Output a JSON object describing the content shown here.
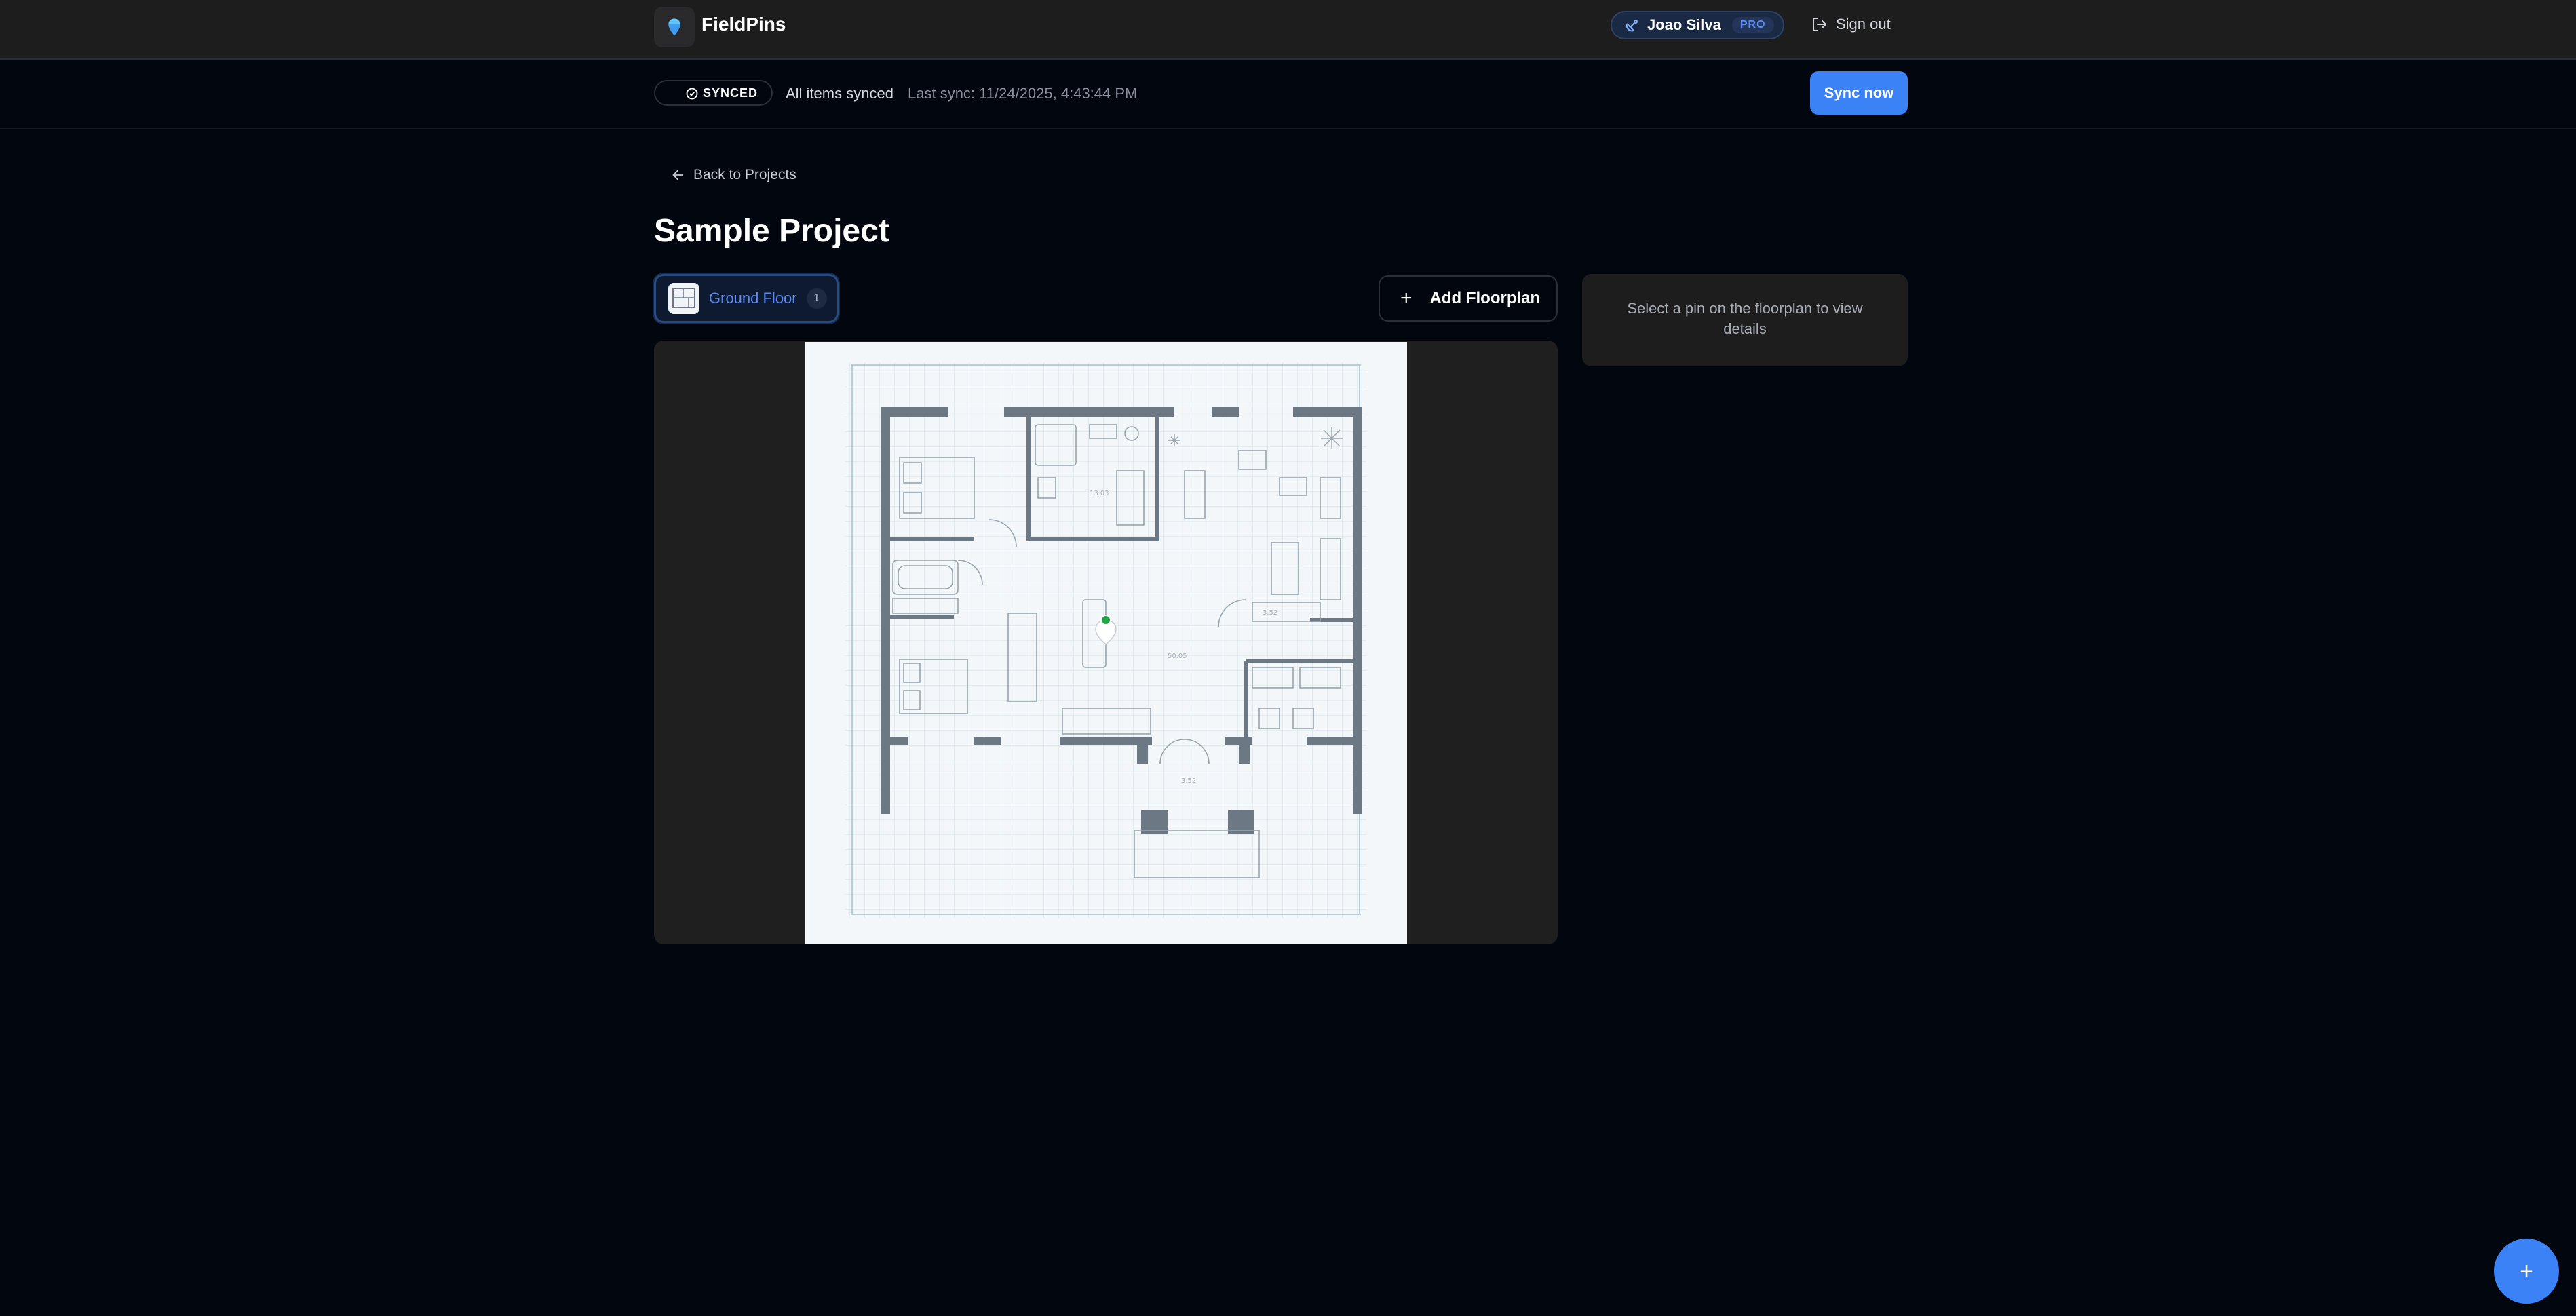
{
  "app": {
    "brand": "FieldPins",
    "logo_icon": "map-pin-icon",
    "accent_color": "#3b82f6"
  },
  "user": {
    "name": "Joao Silva",
    "plan_badge": "PRO",
    "avatar_icon": "satellite-dish-icon"
  },
  "nav": {
    "signout_label": "Sign out"
  },
  "sync": {
    "badge_label": "SYNCED",
    "status_text": "All items synced",
    "last_sync": "Last sync: 11/24/2025, 4:43:44 PM",
    "button_label": "Sync now"
  },
  "project": {
    "back_label": "Back to Projects",
    "title": "Sample Project",
    "floorplans": [
      {
        "name": "Ground Floor",
        "pin_count": "1",
        "selected": true
      }
    ],
    "add_floorplan_label": "Add Floorplan",
    "pin_color": "#22a447"
  },
  "detail_panel": {
    "empty_text": "Select a pin on the floorplan to view details"
  },
  "fab": {
    "label": "+"
  }
}
